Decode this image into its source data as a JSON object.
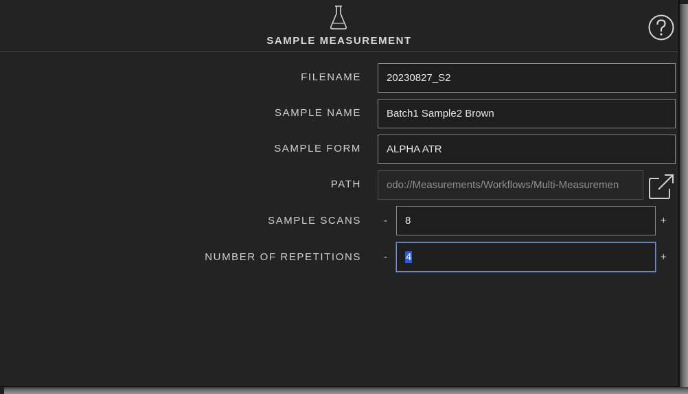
{
  "header": {
    "title": "SAMPLE MEASUREMENT",
    "icon": "flask-icon",
    "help_icon": "help-icon"
  },
  "form": {
    "filename": {
      "label": "FILENAME",
      "value": "20230827_S2"
    },
    "sample_name": {
      "label": "SAMPLE NAME",
      "value": "Batch1 Sample2 Brown"
    },
    "sample_form": {
      "label": "SAMPLE FORM",
      "value": "ALPHA ATR"
    },
    "path": {
      "label": "PATH",
      "value": "odo://Measurements/Workflows/Multi-Measuremen",
      "action_icon": "open-external-icon"
    },
    "sample_scans": {
      "label": "SAMPLE SCANS",
      "value": "8",
      "minus": "-",
      "plus": "+"
    },
    "repetitions": {
      "label": "NUMBER OF REPETITIONS",
      "value": "4",
      "minus": "-",
      "plus": "+"
    }
  },
  "colors": {
    "background": "#232323",
    "field_border": "#8a8a8a",
    "focus_border": "#6f8fc9",
    "selection": "#2a5bd7"
  }
}
